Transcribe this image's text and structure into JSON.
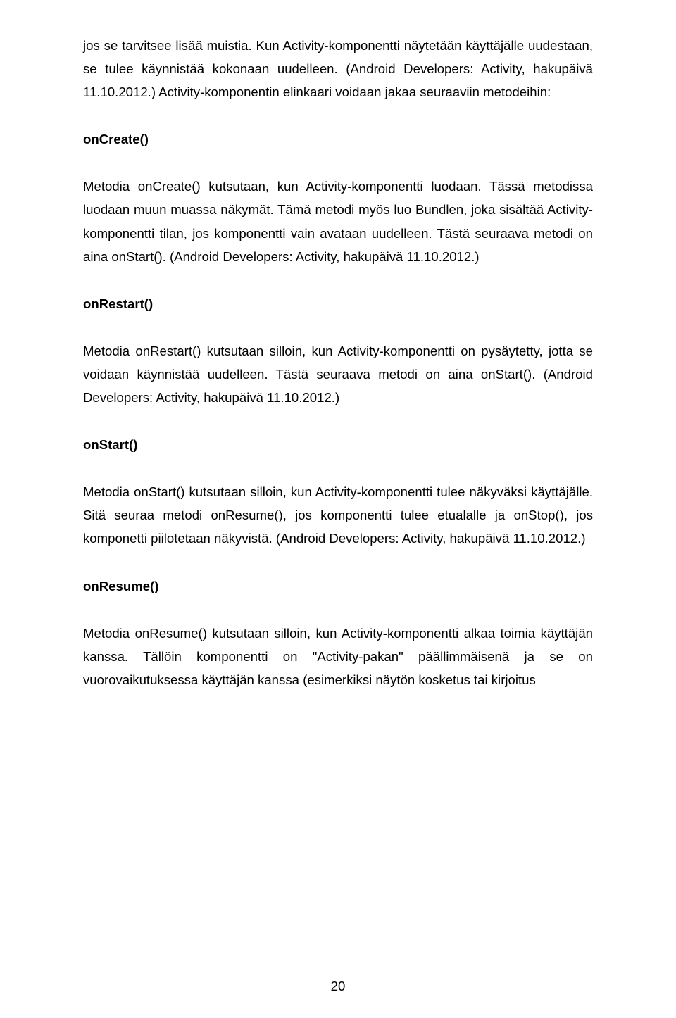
{
  "para1": "jos se tarvitsee lisää muistia. Kun Activity-komponentti näytetään käyttäjälle uudestaan, se tulee käynnistää kokonaan uudelleen. (Android Developers: Activity, hakupäivä 11.10.2012.) Activity-komponentin elinkaari voidaan jakaa seuraaviin metodeihin:",
  "h1": "onCreate()",
  "para2": "Metodia onCreate() kutsutaan, kun Activity-komponentti luodaan. Tässä metodissa luodaan muun muassa näkymät. Tämä metodi myös luo Bundlen, joka sisältää Activity-komponentti tilan, jos komponentti vain avataan uudelleen. Tästä seuraava metodi on aina onStart(). (Android Developers: Activity, hakupäivä 11.10.2012.)",
  "h2": "onRestart()",
  "para3": "Metodia onRestart() kutsutaan silloin, kun Activity-komponentti on pysäytetty, jotta se voidaan käynnistää uudelleen. Tästä seuraava metodi on aina onStart(). (Android Developers: Activity, hakupäivä 11.10.2012.)",
  "h3": "onStart()",
  "para4": "Metodia onStart() kutsutaan silloin, kun Activity-komponentti tulee näkyväksi käyttäjälle. Sitä seuraa metodi onResume(), jos komponentti tulee etualalle ja onStop(), jos komponetti piilotetaan näkyvistä. (Android Developers: Activity, hakupäivä 11.10.2012.)",
  "h4": "onResume()",
  "para5": "Metodia onResume() kutsutaan silloin, kun Activity-komponentti alkaa toimia käyttäjän kanssa. Tällöin komponentti on \"Activity-pakan\" päällimmäisenä ja se on vuorovaikutuksessa käyttäjän kanssa (esimerkiksi näytön kosketus tai kirjoitus",
  "pageNumber": "20"
}
